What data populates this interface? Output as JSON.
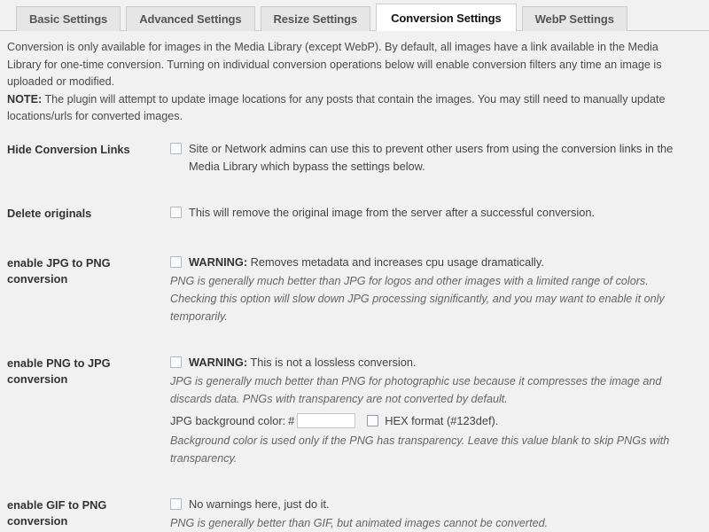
{
  "tabs": [
    {
      "label": "Basic Settings",
      "active": false
    },
    {
      "label": "Advanced Settings",
      "active": false
    },
    {
      "label": "Resize Settings",
      "active": false
    },
    {
      "label": "Conversion Settings",
      "active": true
    },
    {
      "label": "WebP Settings",
      "active": false
    }
  ],
  "intro": {
    "paragraph1": "Conversion is only available for images in the Media Library (except WebP). By default, all images have a link available in the Media Library for one-time conversion. Turning on individual conversion operations below will enable conversion filters any time an image is uploaded or modified.",
    "note_label": "NOTE:",
    "note_text": " The plugin will attempt to update image locations for any posts that contain the images. You may still need to manually update locations/urls for converted images."
  },
  "rows": {
    "hide_conversion_links": {
      "label": "Hide Conversion Links",
      "checkbox_checked": false,
      "text": "Site or Network admins can use this to prevent other users from using the conversion links in the Media Library which bypass the settings below."
    },
    "delete_originals": {
      "label": "Delete originals",
      "checkbox_checked": false,
      "text": "This will remove the original image from the server after a successful conversion."
    },
    "jpg_to_png": {
      "label": "enable JPG to PNG conversion",
      "checkbox_checked": false,
      "warning_label": "WARNING:",
      "warning_text": " Removes metadata and increases cpu usage dramatically.",
      "description": "PNG is generally much better than JPG for logos and other images with a limited range of colors. Checking this option will slow down JPG processing significantly, and you may want to enable it only temporarily."
    },
    "png_to_jpg": {
      "label": "enable PNG to JPG conversion",
      "checkbox_checked": false,
      "warning_label": "WARNING:",
      "warning_text": " This is not a lossless conversion.",
      "description": "JPG is generally much better than PNG for photographic use because it compresses the image and discards data. PNGs with transparency are not converted by default.",
      "bg_color_label": "JPG background color:",
      "bg_color_hash": "#",
      "bg_color_value": "",
      "bg_color_placeholder": "",
      "hex_format_checked": false,
      "hex_format_label": "HEX format (#123def).",
      "footnote": "Background color is used only if the PNG has transparency. Leave this value blank to skip PNGs with transparency."
    },
    "gif_to_png": {
      "label": "enable GIF to PNG conversion",
      "checkbox_checked": false,
      "text": "No warnings here, just do it.",
      "description": "PNG is generally better than GIF, but animated images cannot be converted."
    }
  },
  "colors": {
    "page_background": "#f1f1f1",
    "active_tab_background": "#ffffff",
    "inactive_tab_background": "#e6e6e6",
    "border": "#cccccc",
    "text": "#444444",
    "heading_text": "#333333"
  }
}
